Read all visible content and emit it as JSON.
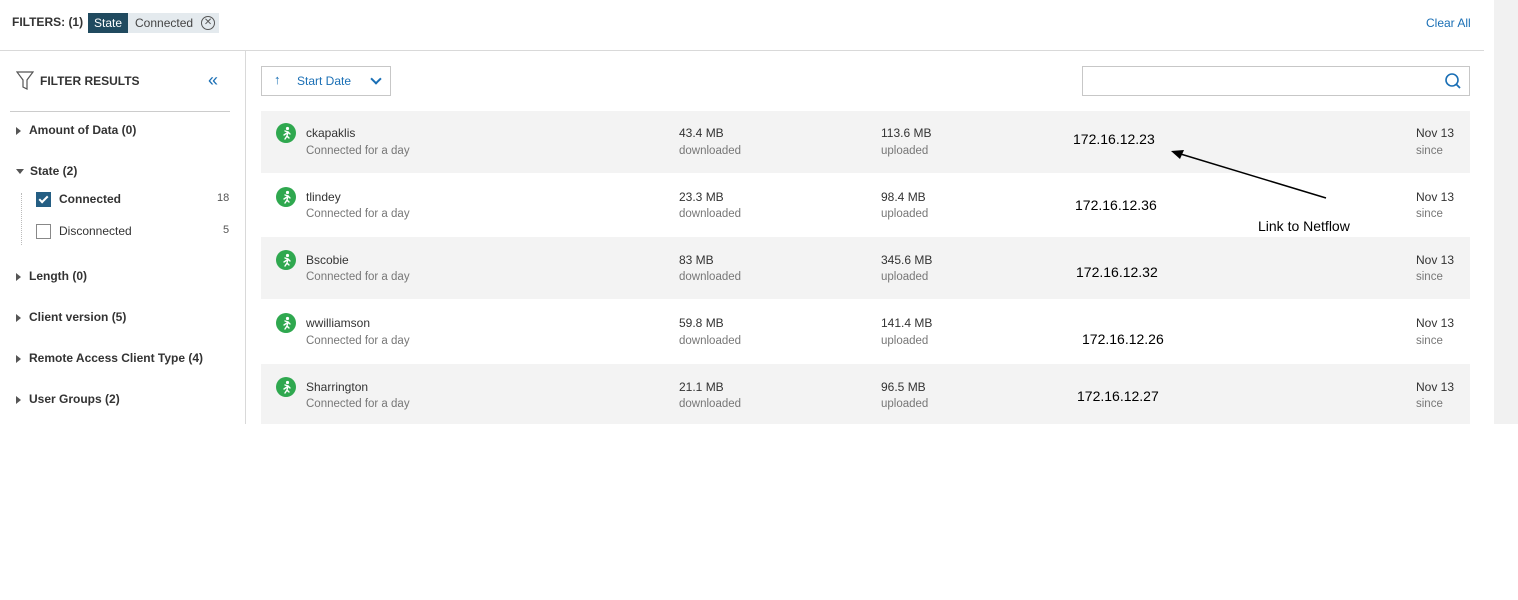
{
  "filters_bar": {
    "label": "FILTERS: (1)",
    "chip": {
      "key": "State",
      "value": "Connected",
      "remove_icon": "close-circle-icon"
    },
    "clear_all": "Clear All"
  },
  "sidebar": {
    "title": "FILTER RESULTS",
    "icon": "funnel-icon",
    "collapse_icon": "double-chevron-left-icon",
    "groups": [
      {
        "label": "Amount of Data (0)",
        "expanded": false
      },
      {
        "label": "State (2)",
        "expanded": true,
        "options": [
          {
            "label": "Connected",
            "count": "18",
            "checked": true
          },
          {
            "label": "Disconnected",
            "count": "5",
            "checked": false
          }
        ]
      },
      {
        "label": "Length (0)",
        "expanded": false
      },
      {
        "label": "Client version (5)",
        "expanded": false
      },
      {
        "label": "Remote Access Client Type (4)",
        "expanded": false
      },
      {
        "label": "User Groups (2)",
        "expanded": false
      }
    ]
  },
  "toolbar": {
    "sort_label": "Start Date",
    "sort_icon": "arrow-up-icon",
    "dropdown_icon": "chevron-down-icon",
    "search_value": "",
    "search_icon": "search-icon"
  },
  "rows": [
    {
      "user": "ckapaklis",
      "status": "Connected for a day",
      "downloaded": "43.4 MB",
      "downloaded_label": "downloaded",
      "uploaded": "113.6 MB",
      "uploaded_label": "uploaded",
      "ip": "172.16.12.23",
      "date": "Nov 13",
      "date_label": "since"
    },
    {
      "user": "tlindey",
      "status": "Connected for a day",
      "downloaded": "23.3 MB",
      "downloaded_label": "downloaded",
      "uploaded": "98.4 MB",
      "uploaded_label": "uploaded",
      "ip": "172.16.12.36",
      "date": "Nov 13",
      "date_label": "since"
    },
    {
      "user": "Bscobie",
      "status": "Connected for a day",
      "downloaded": "83 MB",
      "downloaded_label": "downloaded",
      "uploaded": "345.6 MB",
      "uploaded_label": "uploaded",
      "ip": "172.16.12.32",
      "date": "Nov 13",
      "date_label": "since"
    },
    {
      "user": "wwilliamson",
      "status": "Connected for a day",
      "downloaded": "59.8 MB",
      "downloaded_label": "downloaded",
      "uploaded": "141.4 MB",
      "uploaded_label": "uploaded",
      "ip": "172.16.12.26",
      "date": "Nov 13",
      "date_label": "since"
    },
    {
      "user": "Sharrington",
      "status": "Connected for a day",
      "downloaded": "21.1 MB",
      "downloaded_label": "downloaded",
      "uploaded": "96.5 MB",
      "uploaded_label": "uploaded",
      "ip": "172.16.12.27",
      "date": "Nov 13",
      "date_label": "since"
    }
  ],
  "annotation": {
    "text": "Link to Netflow"
  },
  "colors": {
    "accent": "#1a6fb5",
    "chip_dark": "#204a5f",
    "status_green": "#2fa84f",
    "checkbox": "#245e83"
  }
}
